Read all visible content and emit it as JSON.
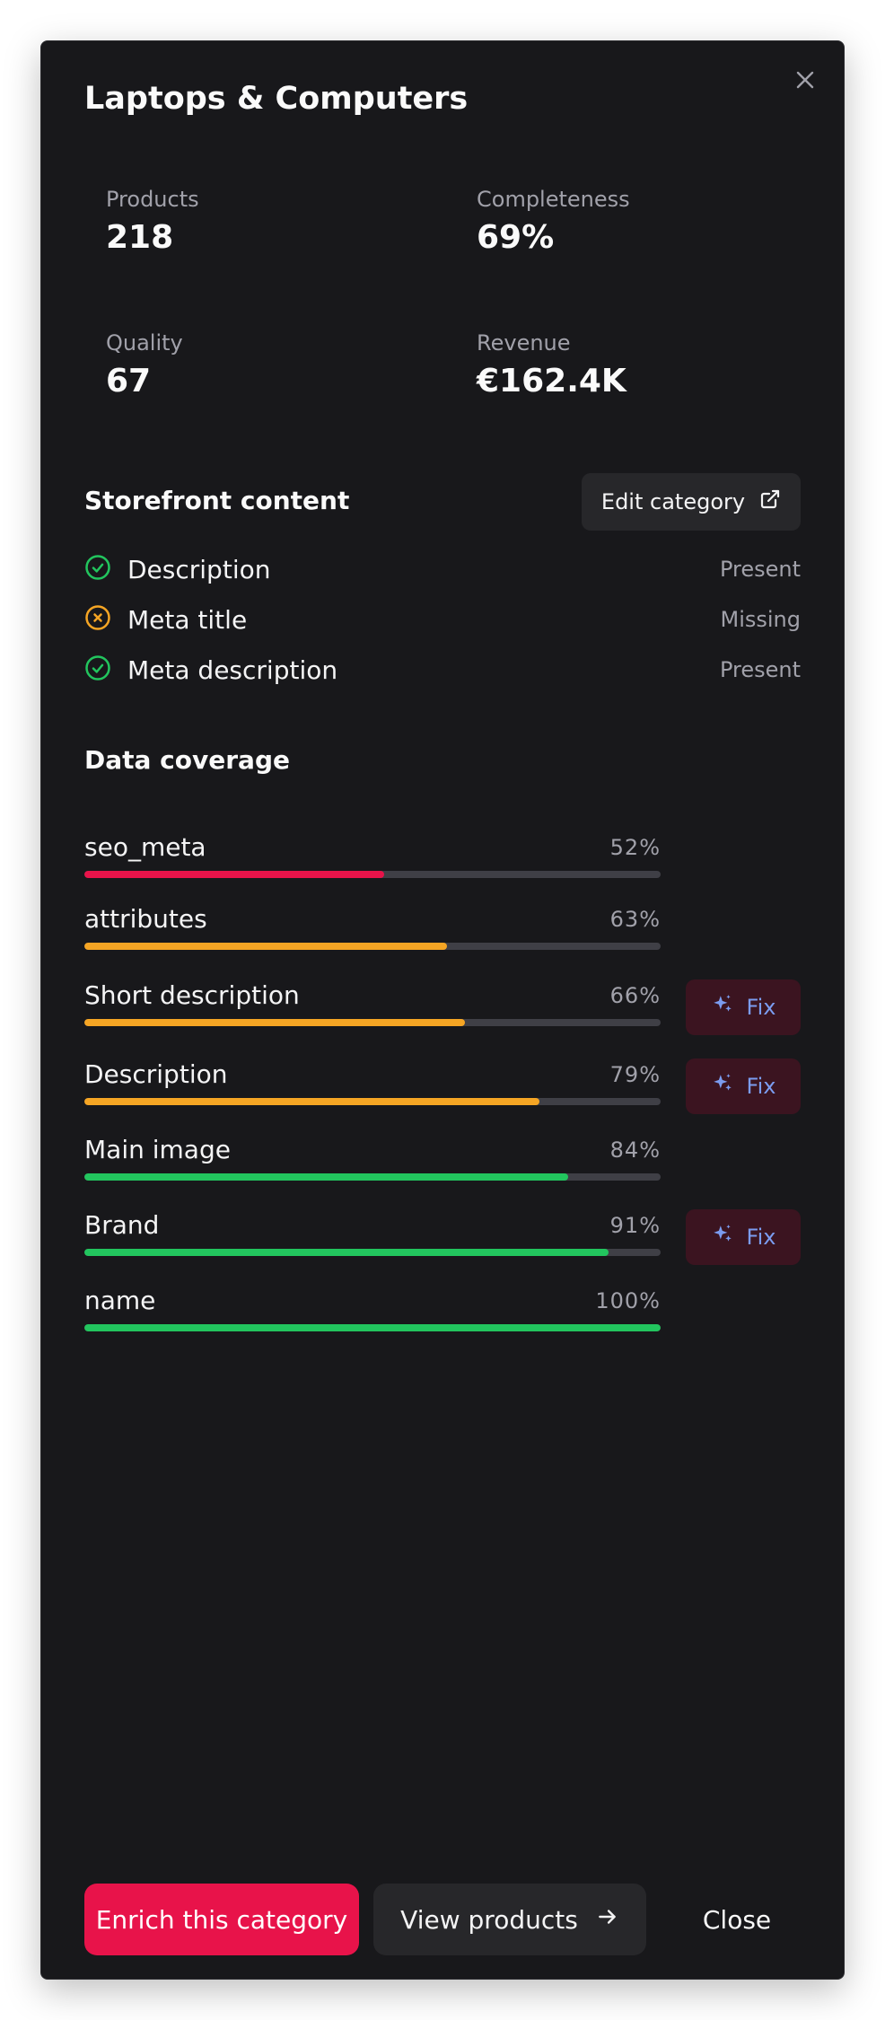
{
  "dialog": {
    "title": "Laptops & Computers",
    "close_icon": "close-icon"
  },
  "stats": [
    {
      "label": "Products",
      "value": "218"
    },
    {
      "label": "Completeness",
      "value": "69%"
    },
    {
      "label": "Quality",
      "value": "67"
    },
    {
      "label": "Revenue",
      "value": "€162.4K"
    }
  ],
  "storefront": {
    "title": "Storefront content",
    "edit_label": "Edit category",
    "edit_icon": "external-link-icon",
    "items": [
      {
        "label": "Description",
        "status": "Present",
        "state": "present",
        "icon": "check-circle-icon"
      },
      {
        "label": "Meta title",
        "status": "Missing",
        "state": "missing",
        "icon": "x-circle-icon"
      },
      {
        "label": "Meta description",
        "status": "Present",
        "state": "present",
        "icon": "check-circle-icon"
      }
    ]
  },
  "coverage": {
    "title": "Data coverage",
    "fix_label": "Fix",
    "fix_icon": "sparkles-icon",
    "rows": [
      {
        "name": "seo_meta",
        "pct": "52%",
        "value": 52,
        "fix": false
      },
      {
        "name": "attributes",
        "pct": "63%",
        "value": 63,
        "fix": false
      },
      {
        "name": "Short description",
        "pct": "66%",
        "value": 66,
        "fix": true
      },
      {
        "name": "Description",
        "pct": "79%",
        "value": 79,
        "fix": true
      },
      {
        "name": "Main image",
        "pct": "84%",
        "value": 84,
        "fix": false
      },
      {
        "name": "Brand",
        "pct": "91%",
        "value": 91,
        "fix": true
      },
      {
        "name": "name",
        "pct": "100%",
        "value": 100,
        "fix": false
      }
    ]
  },
  "footer": {
    "enrich_label": "Enrich this category",
    "view_label": "View products",
    "view_icon": "arrow-right-icon",
    "close_label": "Close"
  },
  "colors": {
    "accent": "#e8134a",
    "success": "#22c55e",
    "warning": "#f5a524",
    "danger": "#e8134a",
    "fix_text": "#7b9cf0"
  }
}
